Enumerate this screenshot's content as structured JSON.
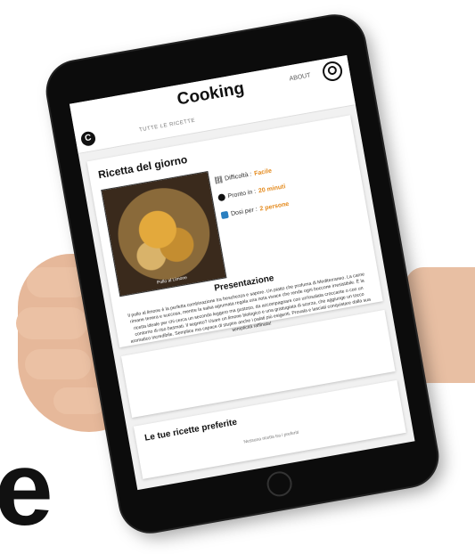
{
  "app": {
    "title": "Cooking",
    "logo_letter": "C",
    "nav_about": "ABOUT",
    "nav_all_recipes": "TUTTE LE RICETTE"
  },
  "recipe": {
    "card_title": "Ricetta del giorno",
    "photo_caption": "Pollo al Limone",
    "difficulty_label": "Difficoltà :",
    "difficulty_value": "Facile",
    "prep_label": "Pronto in :",
    "prep_value": "20 minuti",
    "serves_label": "Dosi per :",
    "serves_value": "2 persone",
    "section_title": "Presentazione",
    "description": "Il pollo al limone è la perfetta combinazione tra freschezza e sapore. Un piatto che profuma di Mediterraneo. La carne rimane tenera e succosa, mentre la salsa agrumata regala una nota vivace che rende ogni boccone irresistibile. È la ricetta ideale per chi cerca un secondo leggero ma gustoso, da accompagnare con un'insalata croccante o con un contorno di riso basmati. Il segreto? Usare un limone biologico e una grattugiata di scorza, che aggiunge un tocco aromatico incredibile. Semplice ma capace di stupire anche i palati più esigenti. Provala e lasciati conquistare dalla sua semplicità raffinata!"
  },
  "favorites": {
    "title": "Le tue ricette preferite",
    "empty_text": "Nessuna ricetta tra i preferiti"
  },
  "colors": {
    "accent": "#e48a1d",
    "device": "#0c0c0c"
  },
  "decor": {
    "big_letter": "e"
  }
}
